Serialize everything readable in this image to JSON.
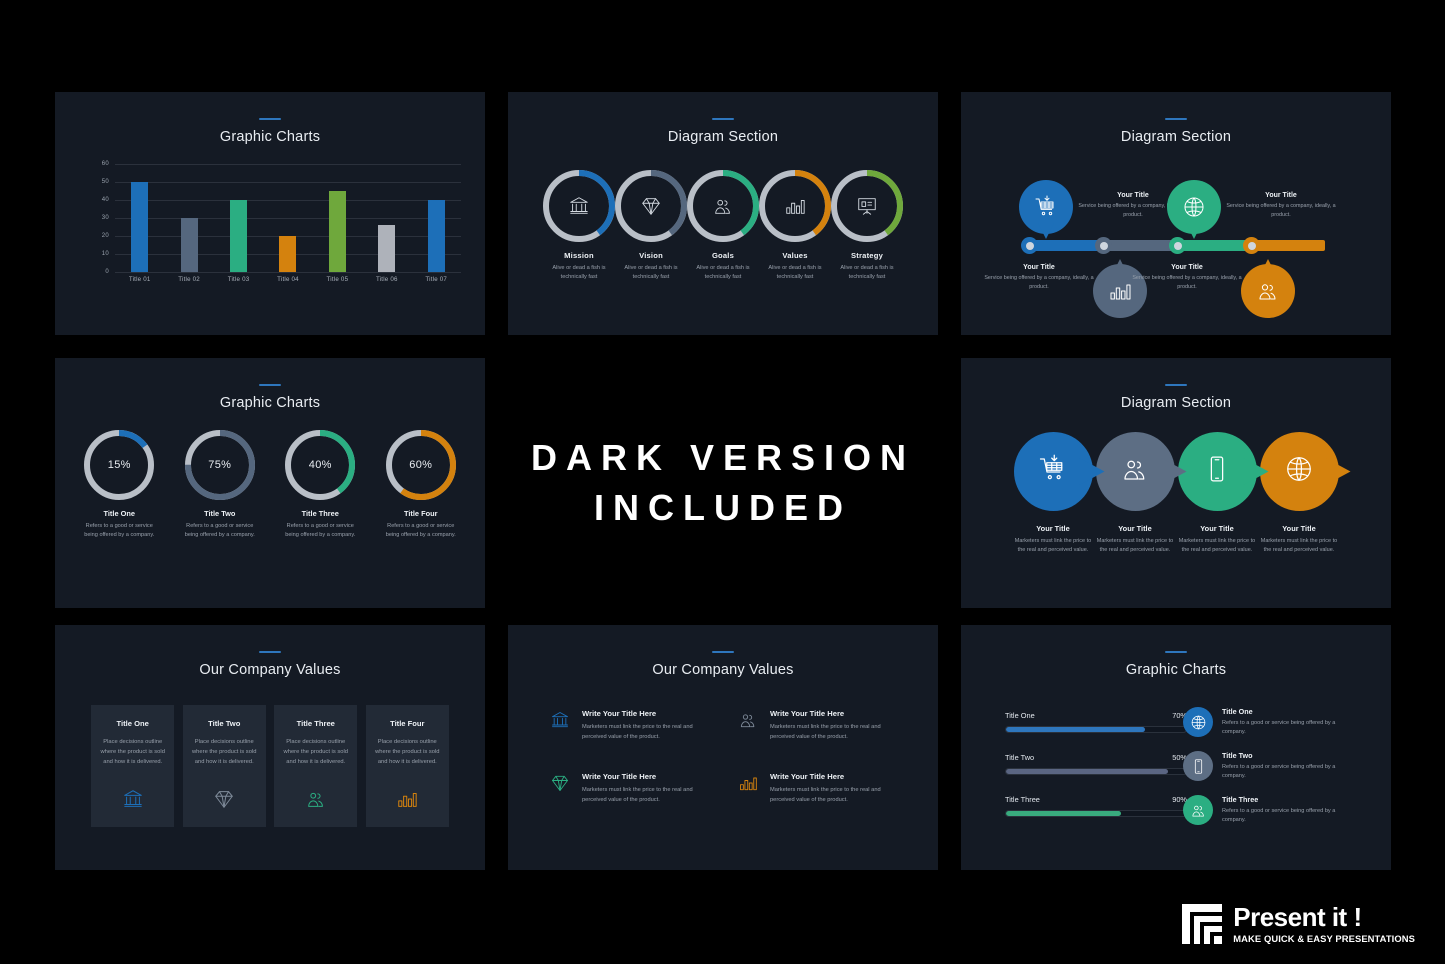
{
  "page": {
    "background": "#000000",
    "panel_background": "#141a24",
    "accent_color": "#2e76bd"
  },
  "palette": {
    "blue": "#1d6fb8",
    "slate": "#55677e",
    "green": "#2bae82",
    "orange": "#d4820e",
    "olive": "#6fa83c",
    "light_gray": "#aeb2ba",
    "ring_gray": "#b9bfc7"
  },
  "hero": {
    "line1": "DARK VERSION",
    "line2": "INCLUDED"
  },
  "logo": {
    "name": "Present it !",
    "tagline": "MAKE QUICK & EASY PRESENTATIONS",
    "mark_icon": "square-spiral-icon"
  },
  "slides": {
    "bar_chart": {
      "title": "Graphic Charts",
      "chart_data": {
        "type": "bar",
        "title": "Graphic Charts",
        "xlabel": "",
        "ylabel": "",
        "ylim": [
          0,
          60
        ],
        "yticks": [
          60,
          50,
          40,
          30,
          20,
          10,
          0
        ],
        "grid": true,
        "categories": [
          "Title 01",
          "Title 02",
          "Title 03",
          "Title 04",
          "Title 05",
          "Title 06",
          "Title 07"
        ],
        "values": [
          50,
          30,
          40,
          20,
          45,
          26,
          40
        ],
        "colors": [
          "#1d6fb8",
          "#55677e",
          "#2bae82",
          "#d4820e",
          "#6fa83c",
          "#aeb2ba",
          "#1d6fb8"
        ]
      }
    },
    "rings": {
      "title": "Diagram Section",
      "items": [
        {
          "name": "Mission",
          "desc": "Alive or dead a fish is technically fast",
          "color": "#1d6fb8",
          "icon": "bank-icon"
        },
        {
          "name": "Vision",
          "desc": "Alive or dead a fish is technically fast",
          "color": "#55677e",
          "icon": "diamond-icon"
        },
        {
          "name": "Goals",
          "desc": "Alive or dead a fish is technically fast",
          "color": "#2bae82",
          "icon": "people-icon"
        },
        {
          "name": "Values",
          "desc": "Alive or dead a fish is technically fast",
          "color": "#d4820e",
          "icon": "bar-chart-icon"
        },
        {
          "name": "Strategy",
          "desc": "Alive or dead a fish is technically fast",
          "color": "#6fa83c",
          "icon": "presentation-icon"
        }
      ]
    },
    "timeline": {
      "title": "Diagram Section",
      "items": [
        {
          "title": "Your Title",
          "desc": "Service being offered by a company, ideally, a product.",
          "color": "#1d6fb8",
          "icon": "cart-icon",
          "position": "up"
        },
        {
          "title": "Your Title",
          "desc": "Service being offered by a company, ideally, a product.",
          "color": "#55677e",
          "icon": "bar-chart-icon",
          "position": "down"
        },
        {
          "title": "Your Title",
          "desc": "Service being offered by a company, ideally, a product.",
          "color": "#2bae82",
          "icon": "globe-icon",
          "position": "up"
        },
        {
          "title": "Your Title",
          "desc": "Service being offered by a company, ideally, a product.",
          "color": "#d4820e",
          "icon": "people-icon",
          "position": "down"
        }
      ]
    },
    "donuts": {
      "title": "Graphic Charts",
      "chart_data": {
        "type": "pie",
        "title": "Graphic Charts",
        "categories": [
          "Title One",
          "Title Two",
          "Title Three",
          "Title Four"
        ],
        "values": [
          15,
          75,
          40,
          60
        ],
        "colors": [
          "#1d6fb8",
          "#55677e",
          "#2bae82",
          "#d4820e"
        ],
        "track_color": "#b9bfc7"
      },
      "items": [
        {
          "value": "15%",
          "name": "Title One",
          "desc": "Refers to a good or service being offered by a company."
        },
        {
          "value": "75%",
          "name": "Title Two",
          "desc": "Refers to a good or service being offered by a company."
        },
        {
          "value": "40%",
          "name": "Title Three",
          "desc": "Refers to a good or service being offered by a company."
        },
        {
          "value": "60%",
          "name": "Title Four",
          "desc": "Refers to a good or service being offered by a company."
        }
      ]
    },
    "chevrons": {
      "title": "Diagram Section",
      "items": [
        {
          "title": "Your Title",
          "desc": "Marketers must link the price to the real and perceived value.",
          "color": "#1d6fb8",
          "icon": "cart-icon"
        },
        {
          "title": "Your Title",
          "desc": "Marketers must link the price to the real and perceived value.",
          "color": "#5d6e84",
          "icon": "people-icon"
        },
        {
          "title": "Your Title",
          "desc": "Marketers must link the price to the real and perceived value.",
          "color": "#2bae82",
          "icon": "phone-icon"
        },
        {
          "title": "Your Title",
          "desc": "Marketers must link the price to the real and perceived value.",
          "color": "#d4820e",
          "icon": "globe-icon"
        }
      ]
    },
    "value_cards": {
      "title": "Our Company Values",
      "items": [
        {
          "title": "Title One",
          "desc": "Place decisions outline where the product is sold and how it is delivered.",
          "color": "#1d6fb8",
          "icon": "bank-icon"
        },
        {
          "title": "Title Two",
          "desc": "Place decisions outline where the product is sold and how it is delivered.",
          "color": "#7e8a99",
          "icon": "diamond-icon"
        },
        {
          "title": "Title Three",
          "desc": "Place decisions outline where the product is sold and how it is delivered.",
          "color": "#2bae82",
          "icon": "people-icon"
        },
        {
          "title": "Title Four",
          "desc": "Place decisions outline where the product is sold and how it is delivered.",
          "color": "#d4820e",
          "icon": "bar-chart-icon"
        }
      ]
    },
    "features": {
      "title": "Our Company Values",
      "items": [
        {
          "title": "Write Your Title Here",
          "desc": "Marketers must link the price to the real and perceived value of the product.",
          "color": "#1d6fb8",
          "icon": "bank-icon"
        },
        {
          "title": "Write Your Title Here",
          "desc": "Marketers must link the price to the real and perceived value of the product.",
          "color": "#7e8a99",
          "icon": "people-icon"
        },
        {
          "title": "Write Your Title Here",
          "desc": "Marketers must link the price to the real and perceived value of the product.",
          "color": "#2bae82",
          "icon": "diamond-icon"
        },
        {
          "title": "Write Your Title Here",
          "desc": "Marketers must link the price to the real and perceived value of the product.",
          "color": "#d4820e",
          "icon": "bar-chart-icon"
        }
      ]
    },
    "progress": {
      "title": "Graphic Charts",
      "chart_data": {
        "type": "bar",
        "title": "Graphic Charts",
        "categories": [
          "Title One",
          "Title Two",
          "Title Three"
        ],
        "values": [
          70,
          50,
          90
        ],
        "labels": [
          "70%",
          "50%",
          "90%"
        ],
        "colors": [
          "#2e76bd",
          "#5a6582",
          "#39ab7e"
        ],
        "fill_widths": [
          77,
          90,
          64
        ]
      },
      "bars": [
        {
          "label": "Title One",
          "pct": "70%",
          "fill": 77,
          "color": "#2e76bd"
        },
        {
          "label": "Title Two",
          "pct": "50%",
          "fill": 90,
          "color": "#5a6582"
        },
        {
          "label": "Title Three",
          "pct": "90%",
          "fill": 64,
          "color": "#39ab7e"
        }
      ],
      "list": [
        {
          "title": "Title One",
          "desc": "Refers to a good or service being offered by a company.",
          "color": "#1d6fb8",
          "icon": "globe-icon"
        },
        {
          "title": "Title Two",
          "desc": "Refers to a good or service being offered by a company.",
          "color": "#5d6e84",
          "icon": "phone-icon"
        },
        {
          "title": "Title Three",
          "desc": "Refers to a good or service being offered by a company.",
          "color": "#2bae82",
          "icon": "people-icon"
        }
      ]
    }
  }
}
